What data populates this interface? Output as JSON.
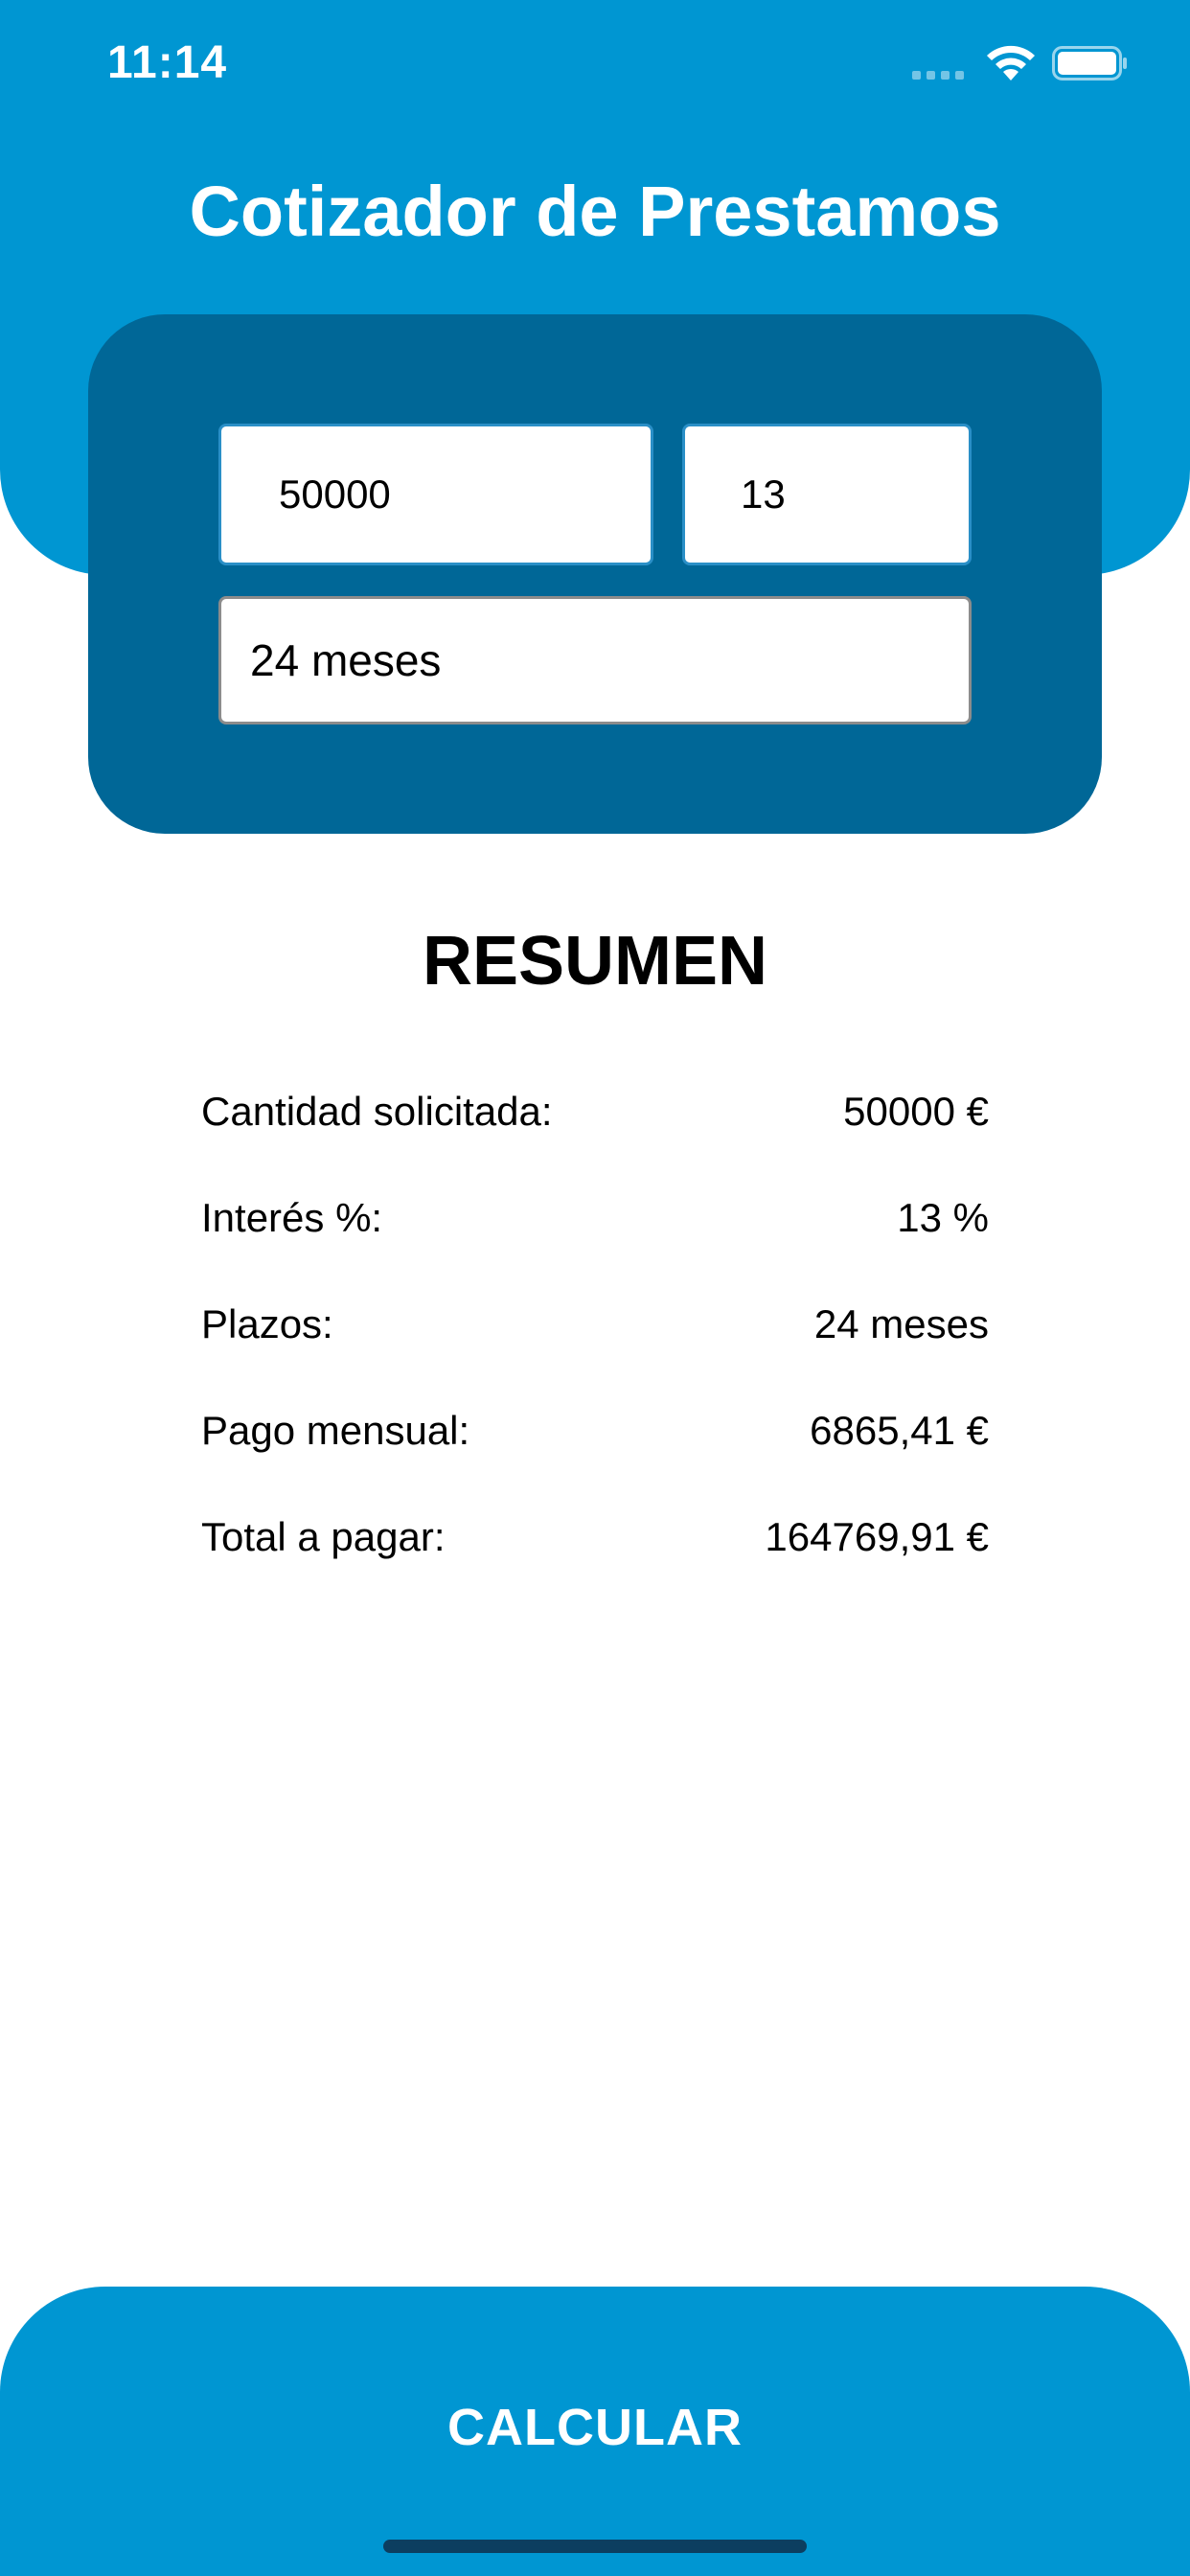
{
  "status_bar": {
    "time": "11:14",
    "signal_icon": "cellular-signal-icon",
    "wifi_icon": "wifi-icon",
    "battery_icon": "battery-icon"
  },
  "header": {
    "title": "Cotizador de Prestamos"
  },
  "form": {
    "amount_value": "50000",
    "interest_value": "13",
    "term_selected": "24 meses"
  },
  "summary": {
    "title": "RESUMEN",
    "rows": [
      {
        "label": "Cantidad solicitada:",
        "value": "50000 €"
      },
      {
        "label": "Interés %:",
        "value": "13 %"
      },
      {
        "label": "Plazos:",
        "value": "24 meses"
      },
      {
        "label": "Pago mensual:",
        "value": "6865,41 €"
      },
      {
        "label": "Total a pagar:",
        "value": "164769,91 €"
      }
    ]
  },
  "actions": {
    "calculate_label": "CALCULAR"
  },
  "colors": {
    "primary": "#0096d2",
    "card": "#006797",
    "text": "#000000",
    "background": "#ffffff"
  }
}
